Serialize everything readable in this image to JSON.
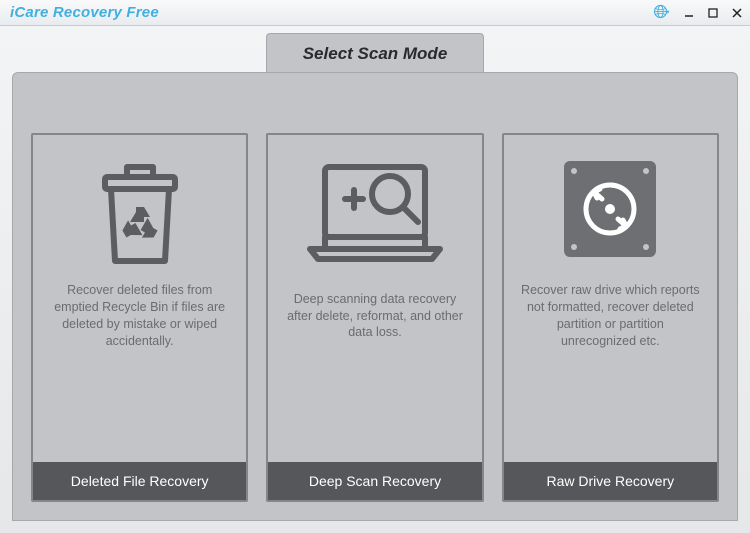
{
  "titlebar": {
    "app_title": "iCare Recovery Free",
    "lang_icon": "globe-icon",
    "lang_chevron": "chevron-down-icon",
    "minimize": "_",
    "maximize": "□",
    "close": "×"
  },
  "main": {
    "tab_label": "Select Scan Mode"
  },
  "cards": [
    {
      "icon": "recycle-bin-icon",
      "description": "Recover deleted files from emptied Recycle Bin if files are deleted by mistake or wiped accidentally.",
      "button_label": "Deleted File Recovery"
    },
    {
      "icon": "laptop-scan-icon",
      "description": "Deep scanning data recovery after delete, reformat, and other data loss.",
      "button_label": "Deep Scan Recovery"
    },
    {
      "icon": "raw-drive-icon",
      "description": "Recover raw drive which reports not formatted, recover deleted partition or partition unrecognized etc.",
      "button_label": "Raw Drive Recovery"
    }
  ]
}
